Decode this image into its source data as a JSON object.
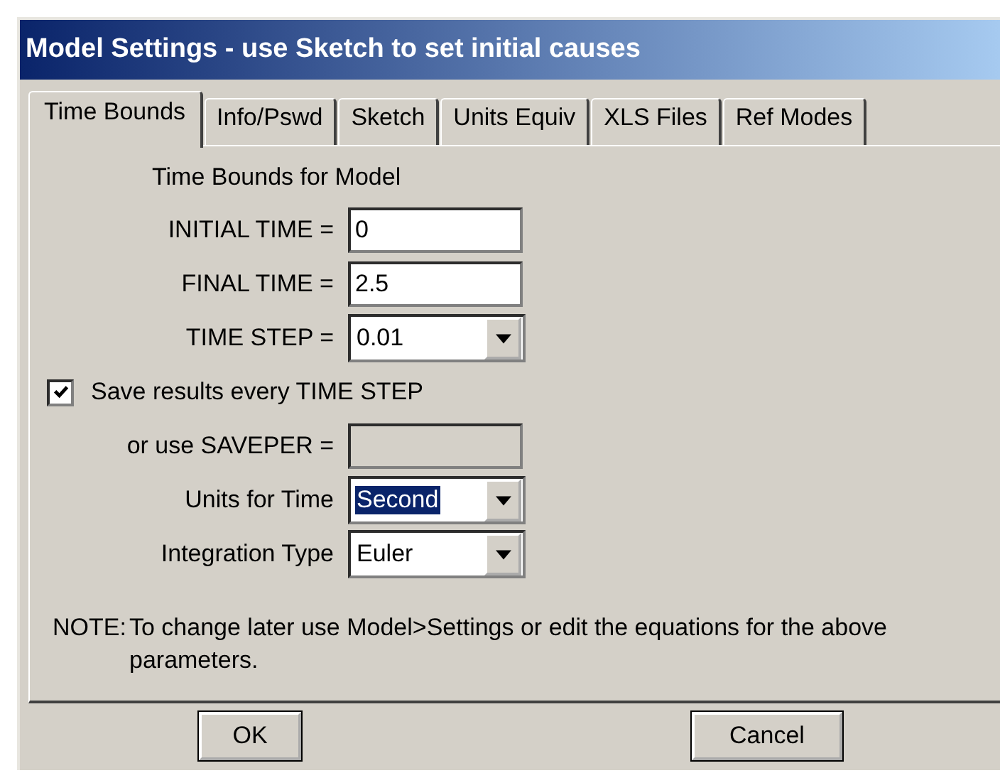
{
  "window": {
    "title": "Model Settings - use Sketch to set initial causes"
  },
  "tabs": [
    {
      "label": "Time Bounds",
      "selected": true
    },
    {
      "label": "Info/Pswd",
      "selected": false
    },
    {
      "label": "Sketch",
      "selected": false
    },
    {
      "label": "Units Equiv",
      "selected": false
    },
    {
      "label": "XLS Files",
      "selected": false
    },
    {
      "label": "Ref Modes",
      "selected": false
    }
  ],
  "section_title": "Time Bounds for Model",
  "fields": [
    {
      "kind": "text",
      "label": "INITIAL TIME =",
      "value": "0",
      "disabled": false
    },
    {
      "kind": "text",
      "label": "FINAL TIME =",
      "value": "2.5",
      "disabled": false
    },
    {
      "kind": "combo",
      "label": "TIME STEP =",
      "value": "0.01",
      "highlighted": false
    },
    {
      "kind": "checkbox",
      "label": "Save results every TIME STEP",
      "checked": true
    },
    {
      "kind": "text",
      "label": "or use SAVEPER =",
      "disabled": true
    },
    {
      "kind": "combo",
      "label": "Units for Time",
      "value": "Second",
      "highlighted": true
    },
    {
      "kind": "combo",
      "label": "Integration Type",
      "value": "Euler",
      "highlighted": false
    }
  ],
  "note": {
    "label": "NOTE:",
    "text": "To change later use Model>Settings or edit the equations for the above parameters."
  },
  "buttons": [
    "OK",
    "Cancel"
  ]
}
